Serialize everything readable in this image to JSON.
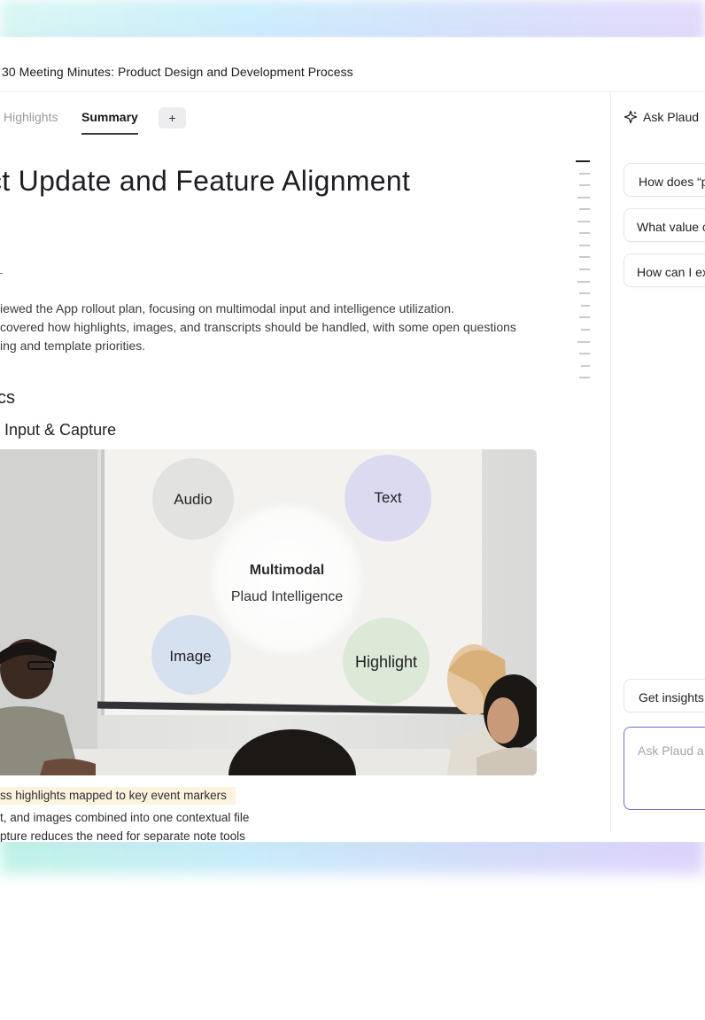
{
  "window": {
    "title": "30 Meeting Minutes: Product Design and Development Process"
  },
  "tabs": [
    {
      "label": "Highlights",
      "active": false
    },
    {
      "label": "Summary",
      "active": true
    }
  ],
  "add_tab_label": "+",
  "summary": {
    "heading": "ct Update and Feature Alignment",
    "paragraph_lines": [
      "iewed the App rollout plan, focusing on multimodal input and intelligence utilization.",
      "covered how highlights, images, and transcripts should be handled, with some open questions",
      "ing and template priorities."
    ],
    "section_heading": "cs",
    "subsection_heading": "l Input & Capture",
    "image": {
      "slide_nodes": [
        "Audio",
        "Text",
        "Image",
        "Highlight"
      ],
      "center_title": "Multimodal",
      "center_subtitle": "Plaud Intelligence"
    },
    "bullets": [
      "ss highlights mapped to key event markers",
      "t, and images combined into one contextual file",
      "pture reduces the need for separate note tools"
    ]
  },
  "ask_panel": {
    "title": "Ask Plaud",
    "suggestions": [
      "How does “p",
      "What value c",
      "How can I ex"
    ],
    "insights_chip": "Get insights",
    "input_placeholder": "Ask Plaud a"
  },
  "colors": {
    "highlight_bg": "#fbf3dc",
    "input_border": "#6d6fd4",
    "audio_circle": "#e2e2e0",
    "text_circle": "#dcdaf0",
    "image_circle": "#d6e1f0",
    "highlight_circle": "#dbe9d6"
  }
}
